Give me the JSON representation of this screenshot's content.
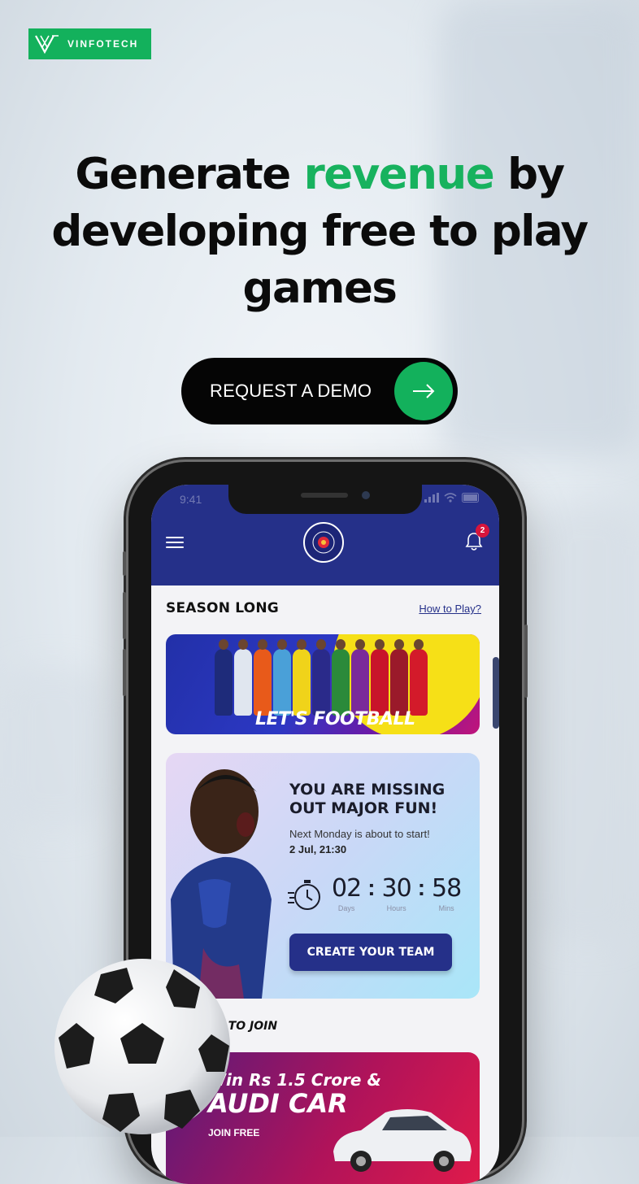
{
  "brand": {
    "name": "VINFOTECH",
    "color": "#13b15c"
  },
  "hero": {
    "headline_part1": "Generate ",
    "headline_accent": "revenue",
    "headline_part2": " by developing free to play games",
    "accent_color": "#17b25e"
  },
  "cta": {
    "label": "REQUEST A DEMO",
    "icon": "arrow-right-icon"
  },
  "phone": {
    "status": {
      "time": "9:41"
    },
    "header": {
      "notification_count": "2",
      "menu_icon": "hamburger-icon",
      "bell_icon": "bell-icon"
    },
    "season": {
      "title": "SEASON LONG",
      "how_to_link": "How to Play?"
    },
    "banner": {
      "text": "LET'S FOOTBALL"
    },
    "missing_card": {
      "title": "YOU ARE MISSING OUT MAJOR FUN!",
      "subtitle": "Next Monday is about to start!",
      "date": "2 Jul, 21:30",
      "countdown": [
        {
          "value": "02",
          "label": "Days"
        },
        {
          "value": "30",
          "label": "Hours"
        },
        {
          "value": "58",
          "label": "Mins"
        }
      ],
      "separator": ":",
      "button_label": "CREATE YOUR TEAM"
    },
    "leagues": {
      "title": "LEAGUES TO JOIN",
      "card": {
        "prize": "Win Rs 1.5 Crore &",
        "car": "AUDI CAR",
        "entry": "JOIN FREE"
      }
    }
  }
}
